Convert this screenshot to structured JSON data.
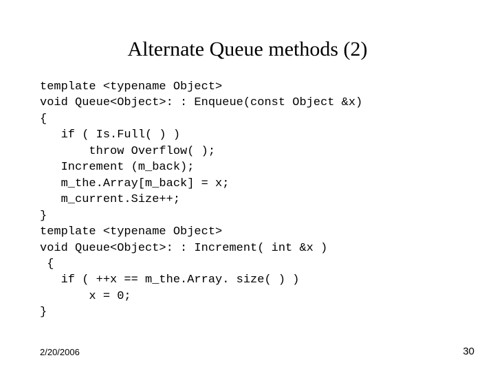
{
  "title": "Alternate Queue methods (2)",
  "code": {
    "l1": "template <typename Object>",
    "l2": "void Queue<Object>: : Enqueue(const Object &x)",
    "l3": "{",
    "l4": "   if ( Is.Full( ) )",
    "l5": "       throw Overflow( );",
    "l6": "   Increment (m_back);",
    "l7": "   m_the.Array[m_back] = x;",
    "l8": "   m_current.Size++;",
    "l9": "}",
    "l10": "template <typename Object>",
    "l11": "void Queue<Object>: : Increment( int &x )",
    "l12": " {",
    "l13": "   if ( ++x == m_the.Array. size( ) )",
    "l14": "       x = 0;",
    "l15": "}"
  },
  "footer": {
    "date": "2/20/2006",
    "page": "30"
  }
}
